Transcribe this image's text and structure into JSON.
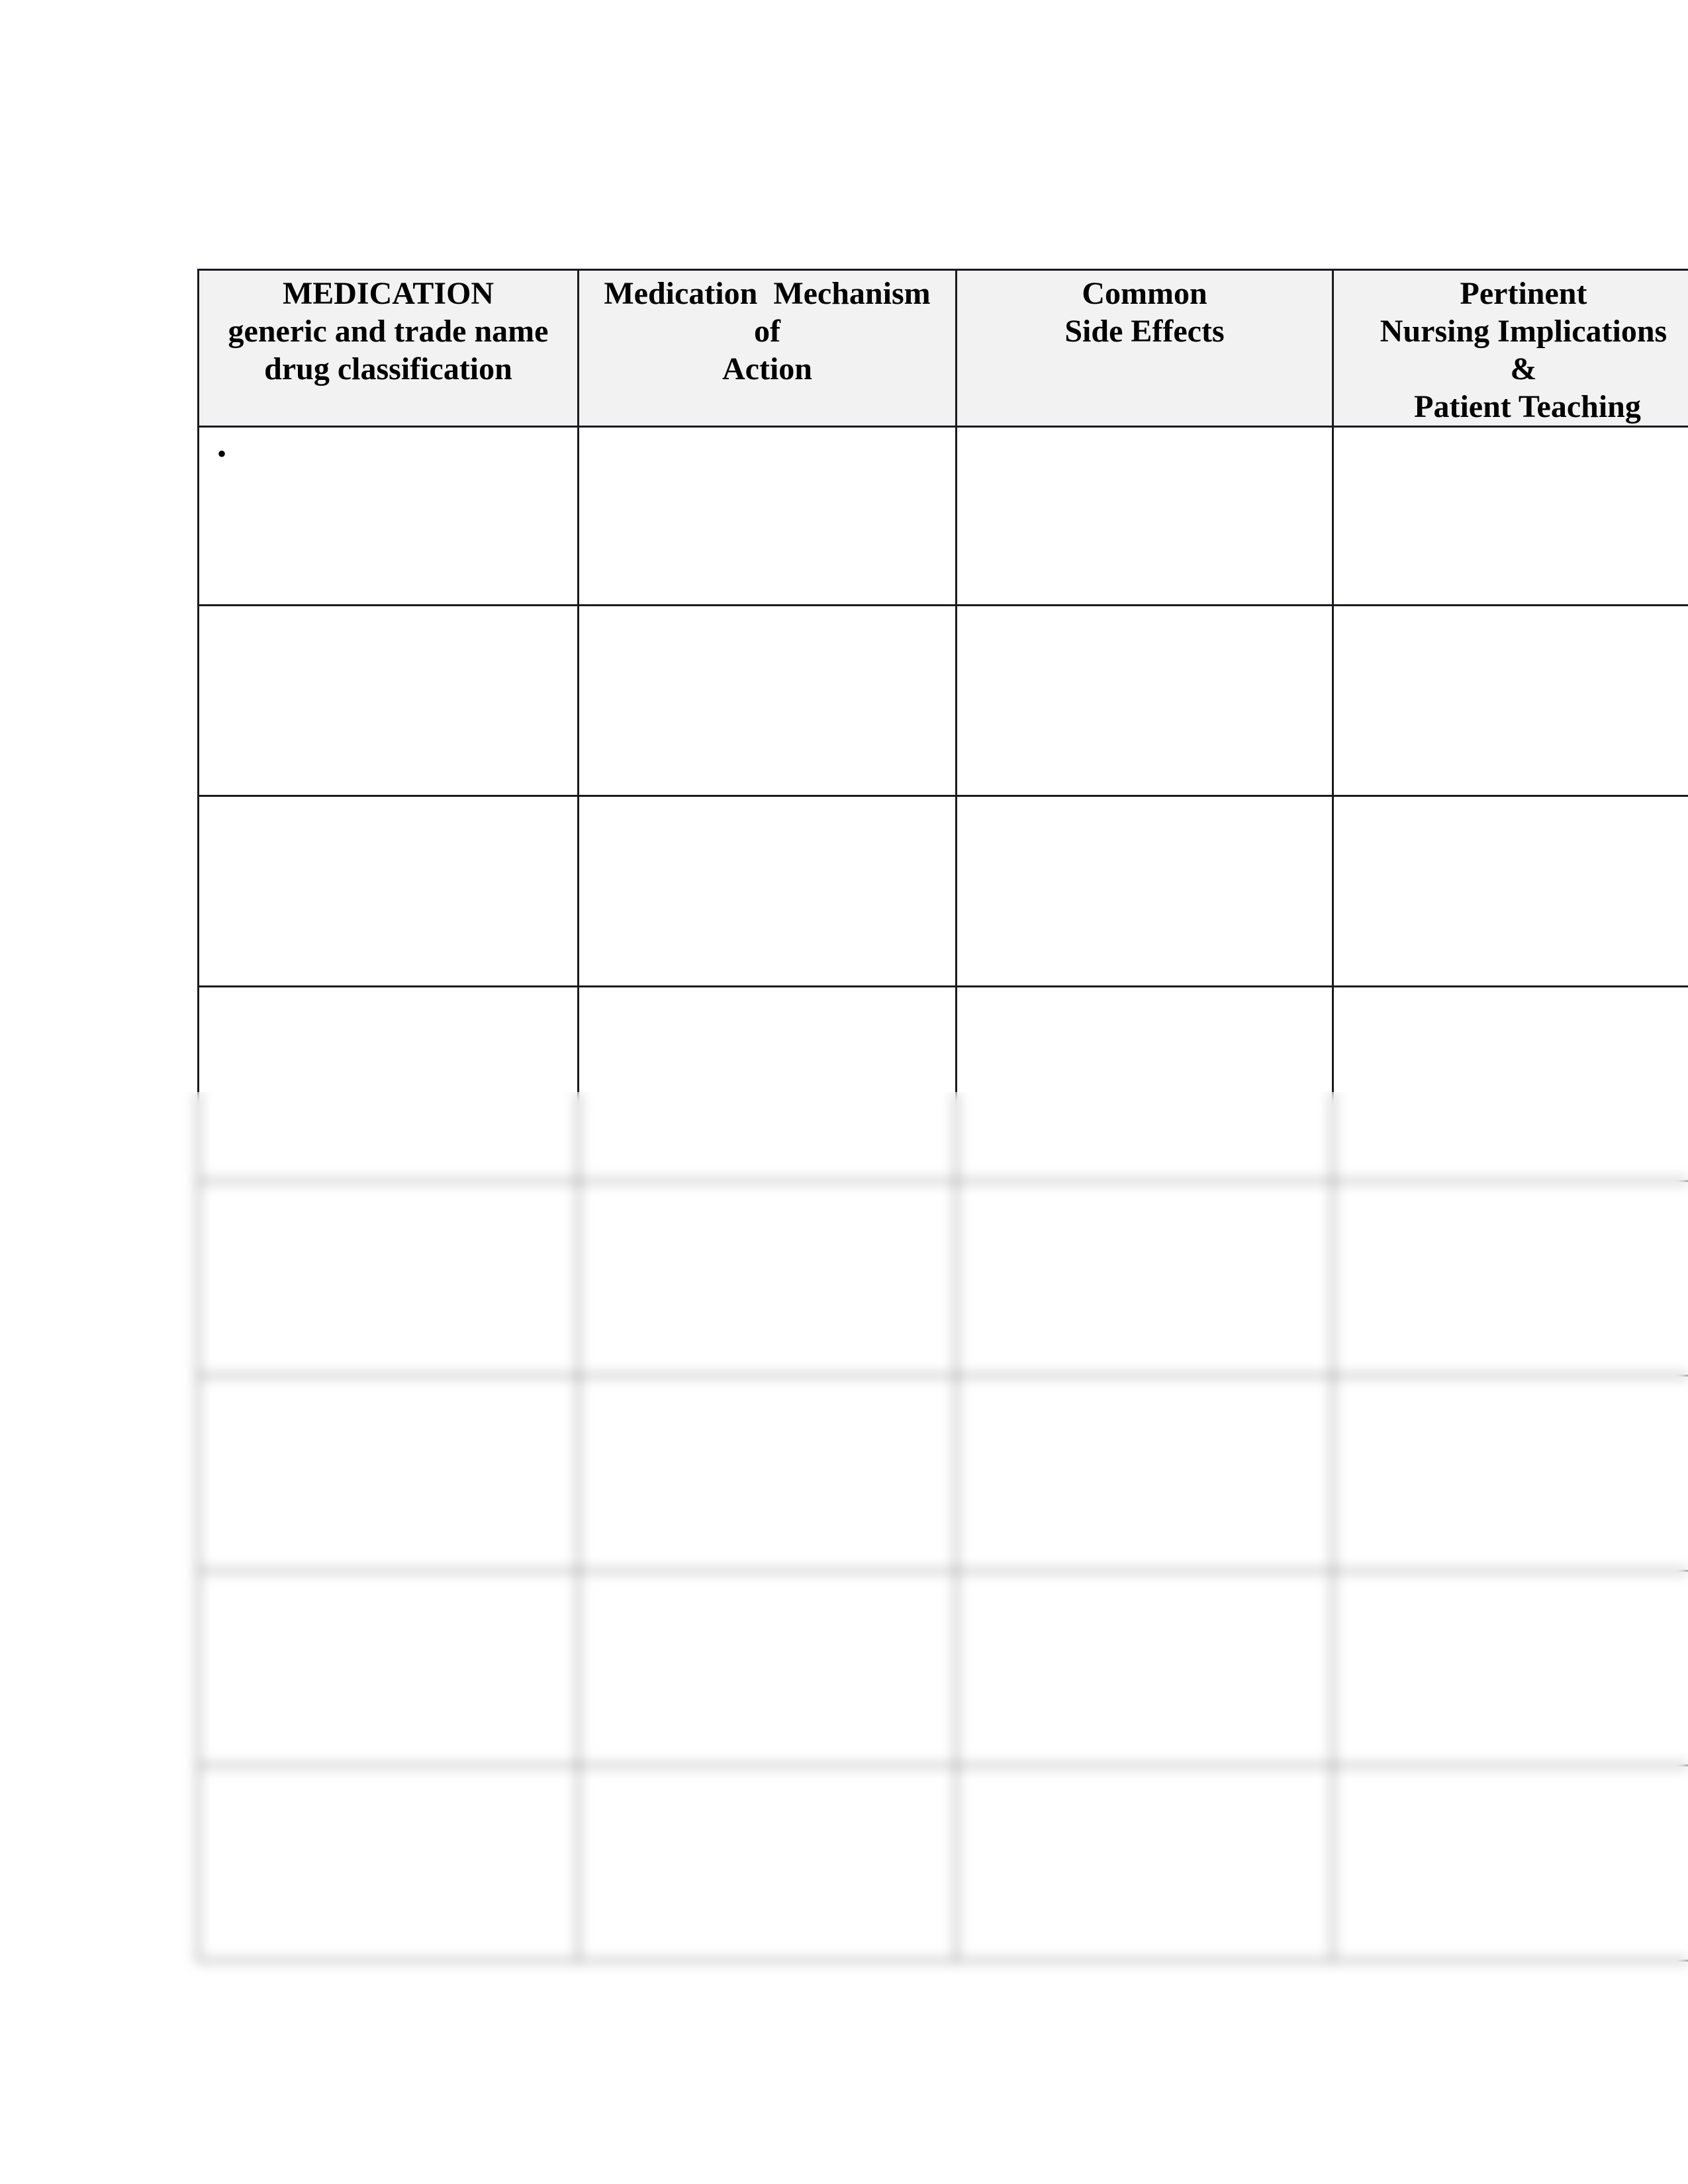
{
  "document": {
    "type": "medication worksheet",
    "table": {
      "headers": [
        {
          "lines": [
            "MEDICATION",
            "generic and trade name",
            "drug classification"
          ]
        },
        {
          "lines": [
            "Medication  Mechanism",
            "of",
            "Action"
          ]
        },
        {
          "lines": [
            "Common",
            "Side Effects"
          ]
        },
        {
          "lines": [
            "Pertinent",
            "Nursing Implications",
            "&",
            " Patient Teaching"
          ]
        }
      ],
      "rows": [
        {
          "cells": [
            "•",
            "",
            "",
            ""
          ]
        },
        {
          "cells": [
            "",
            "",
            "",
            ""
          ]
        },
        {
          "cells": [
            "",
            "",
            "",
            ""
          ]
        },
        {
          "cells": [
            "",
            "",
            "",
            ""
          ]
        },
        {
          "cells": [
            "",
            "",
            "",
            ""
          ]
        },
        {
          "cells": [
            "",
            "",
            "",
            ""
          ]
        },
        {
          "cells": [
            "",
            "",
            "",
            ""
          ]
        },
        {
          "cells": [
            "",
            "",
            "",
            ""
          ]
        }
      ],
      "blurred_rows_note": "lower rows obscured"
    },
    "colors": {
      "header_background": "#f2f2f2",
      "border": "#1a1a1f",
      "text": "#000000"
    }
  }
}
